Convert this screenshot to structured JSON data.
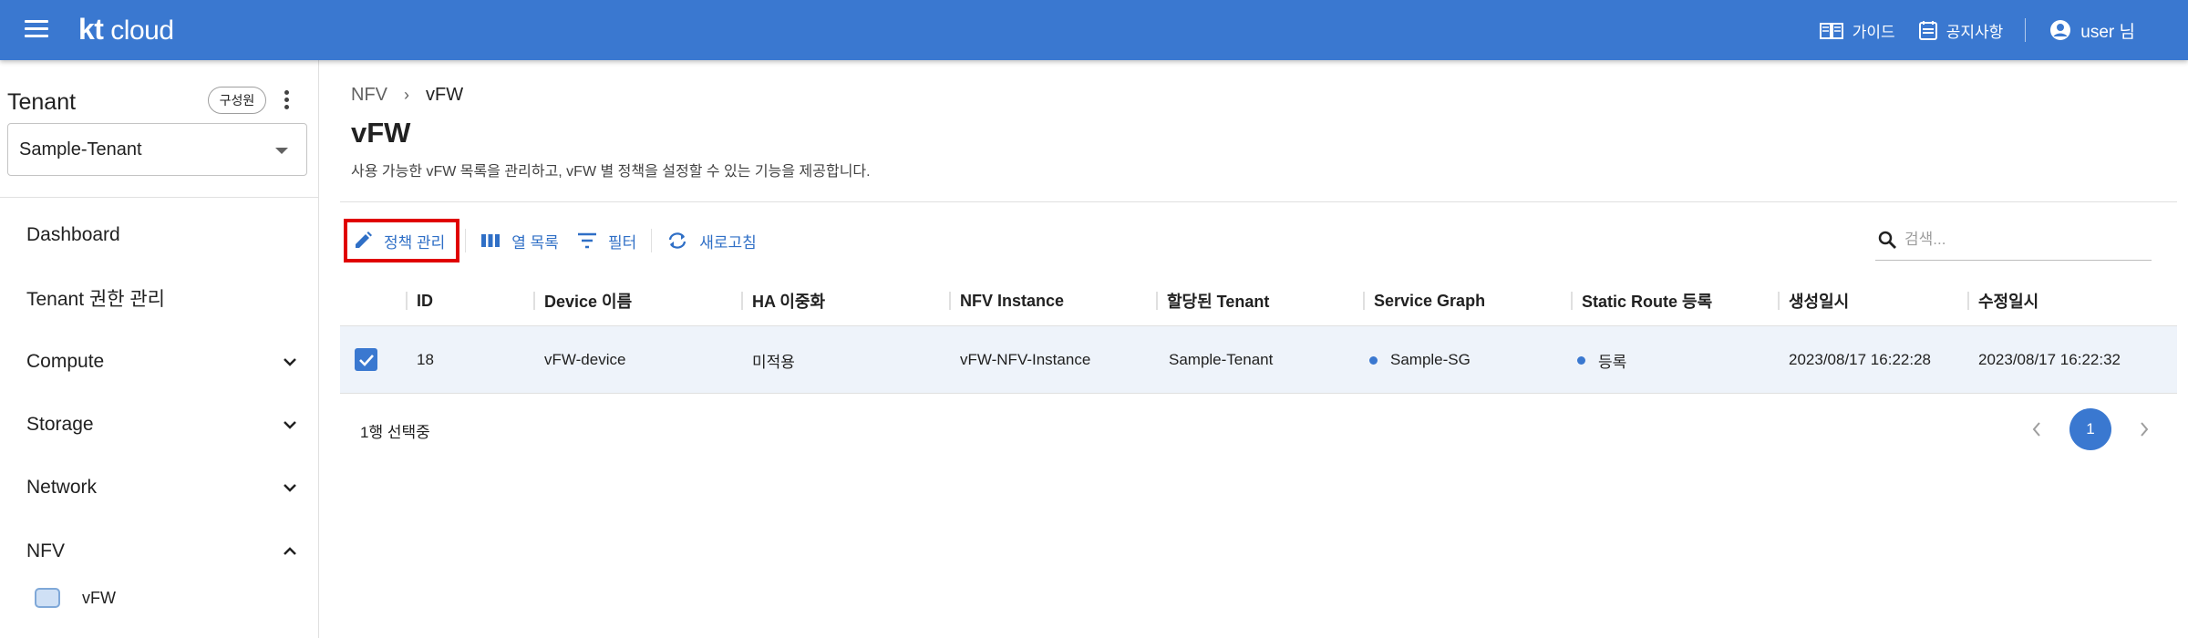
{
  "header": {
    "logo_kt": "kt",
    "logo_cloud": "cloud",
    "guide": "가이드",
    "notice": "공지사항",
    "user": "user 님"
  },
  "sidebar": {
    "tenant_title": "Tenant",
    "member_chip": "구성원",
    "tenant_selected": "Sample-Tenant",
    "items": [
      {
        "label": "Dashboard",
        "expandable": false
      },
      {
        "label": "Tenant 권한 관리",
        "expandable": false
      },
      {
        "label": "Compute",
        "expandable": true,
        "expanded": false
      },
      {
        "label": "Storage",
        "expandable": true,
        "expanded": false
      },
      {
        "label": "Network",
        "expandable": true,
        "expanded": false
      },
      {
        "label": "NFV",
        "expandable": true,
        "expanded": true
      }
    ],
    "subitem": "vFW"
  },
  "breadcrumb": [
    "NFV",
    "vFW"
  ],
  "page": {
    "title": "vFW",
    "description": "사용 가능한 vFW 목록을 관리하고, vFW 별 정책을 설정할 수 있는 기능을 제공합니다."
  },
  "toolbar": {
    "policy": "정책 관리",
    "columns": "열 목록",
    "filter": "필터",
    "refresh": "새로고침"
  },
  "search": {
    "placeholder": "검색..."
  },
  "table": {
    "columns": [
      "ID",
      "Device 이름",
      "HA 이중화",
      "NFV Instance",
      "할당된 Tenant",
      "Service Graph",
      "Static Route 등록",
      "생성일시",
      "수정일시"
    ],
    "rows": [
      {
        "selected": true,
        "id": "18",
        "device": "vFW-device",
        "ha": "미적용",
        "instance": "vFW-NFV-Instance",
        "tenant": "Sample-Tenant",
        "graph": "Sample-SG",
        "route": "등록",
        "created": "2023/08/17 16:22:28",
        "modified": "2023/08/17 16:22:32"
      }
    ]
  },
  "footer": {
    "selected_text": "1행 선택중",
    "page": "1"
  },
  "colors": {
    "primary": "#3a78d0",
    "link": "#2f6fc6",
    "highlight": "#e00000",
    "row_selected": "#eef3fa"
  }
}
